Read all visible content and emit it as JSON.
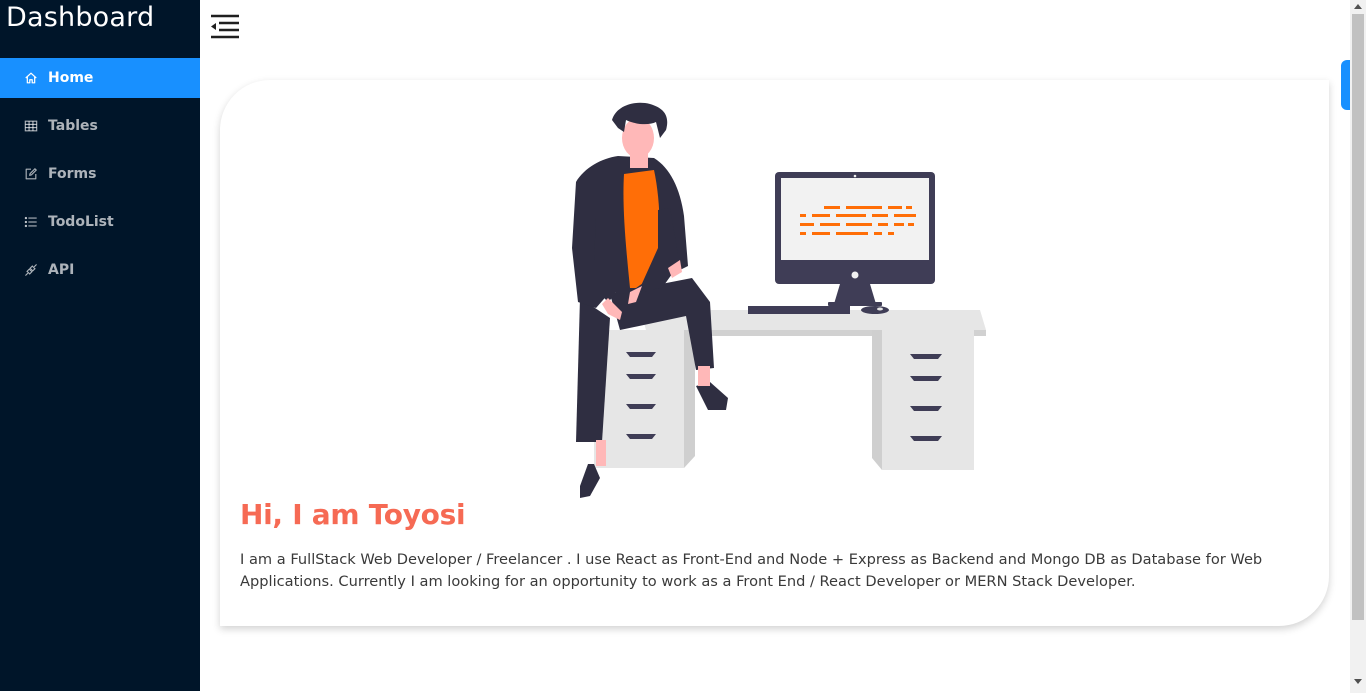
{
  "brand": {
    "title": "Dashboard"
  },
  "sidebar": {
    "items": [
      {
        "label": "Home",
        "icon": "home-icon",
        "active": true
      },
      {
        "label": "Tables",
        "icon": "table-icon",
        "active": false
      },
      {
        "label": "Forms",
        "icon": "form-icon",
        "active": false
      },
      {
        "label": "TodoList",
        "icon": "list-icon",
        "active": false
      },
      {
        "label": "API",
        "icon": "api-icon",
        "active": false
      }
    ]
  },
  "header": {
    "menu_toggle_icon": "menu-fold-icon"
  },
  "hero": {
    "title": "Hi, I am Toyosi",
    "text": "I am a FullStack Web Developer / Freelancer . I use React as Front-End and Node + Express as Backend and Mongo DB as Database for Web Applications. Currently I am looking for an opportunity to work as a Front End / React Developer or MERN Stack Developer."
  },
  "colors": {
    "sidebar_bg": "#001529",
    "accent": "#1890ff",
    "hero_title": "#f66a54",
    "illustration_orange": "#ff6e07",
    "illustration_dark": "#3f3d56"
  }
}
